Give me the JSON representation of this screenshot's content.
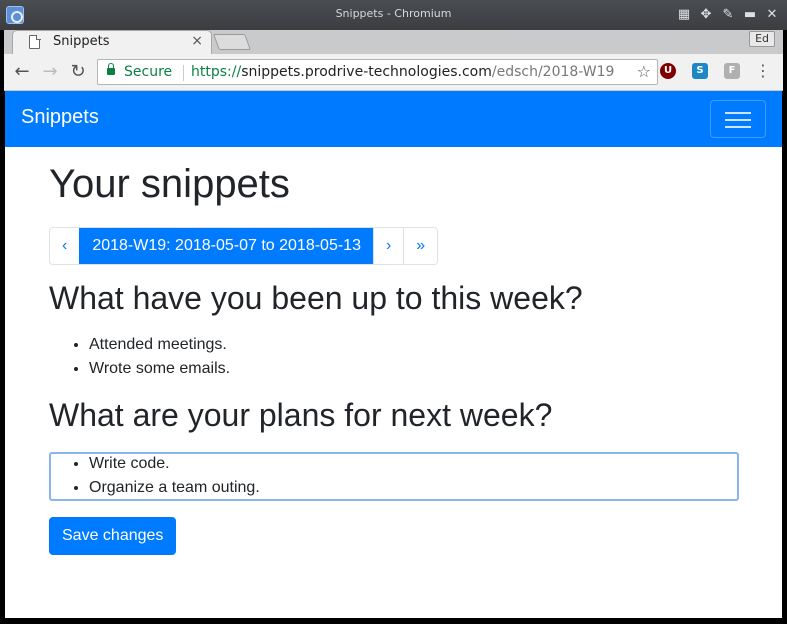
{
  "window": {
    "title": "Snippets - Chromium",
    "profile_badge": "Ed"
  },
  "tabs": [
    {
      "title": "Snippets",
      "close_glyph": "×"
    }
  ],
  "address_bar": {
    "secure_label": "Secure",
    "url_scheme": "https://",
    "url_host": "snippets.prodrive-technologies.com",
    "url_path": "/edsch/2018-W19"
  },
  "extensions": [
    {
      "icon": "ublock-icon",
      "glyph": "U",
      "color": "#800000"
    },
    {
      "icon": "s-extension-icon",
      "glyph": "S",
      "color": "#1e88c7"
    },
    {
      "icon": "f-extension-icon",
      "glyph": "F",
      "color": "#b0b0b0"
    }
  ],
  "navbar": {
    "brand": "Snippets",
    "color": "#007bff"
  },
  "page": {
    "title": "Your snippets",
    "pager": {
      "prev": "‹",
      "current": "2018-W19: 2018-05-07 to 2018-05-13",
      "next": "›",
      "last": "»"
    },
    "done_heading": "What have you been up to this week?",
    "done_items": [
      "Attended meetings.",
      "Wrote some emails."
    ],
    "plans_heading": "What are your plans for next week?",
    "plans_items": [
      "Write code.",
      "Organize a team outing."
    ],
    "save_label": "Save changes"
  }
}
